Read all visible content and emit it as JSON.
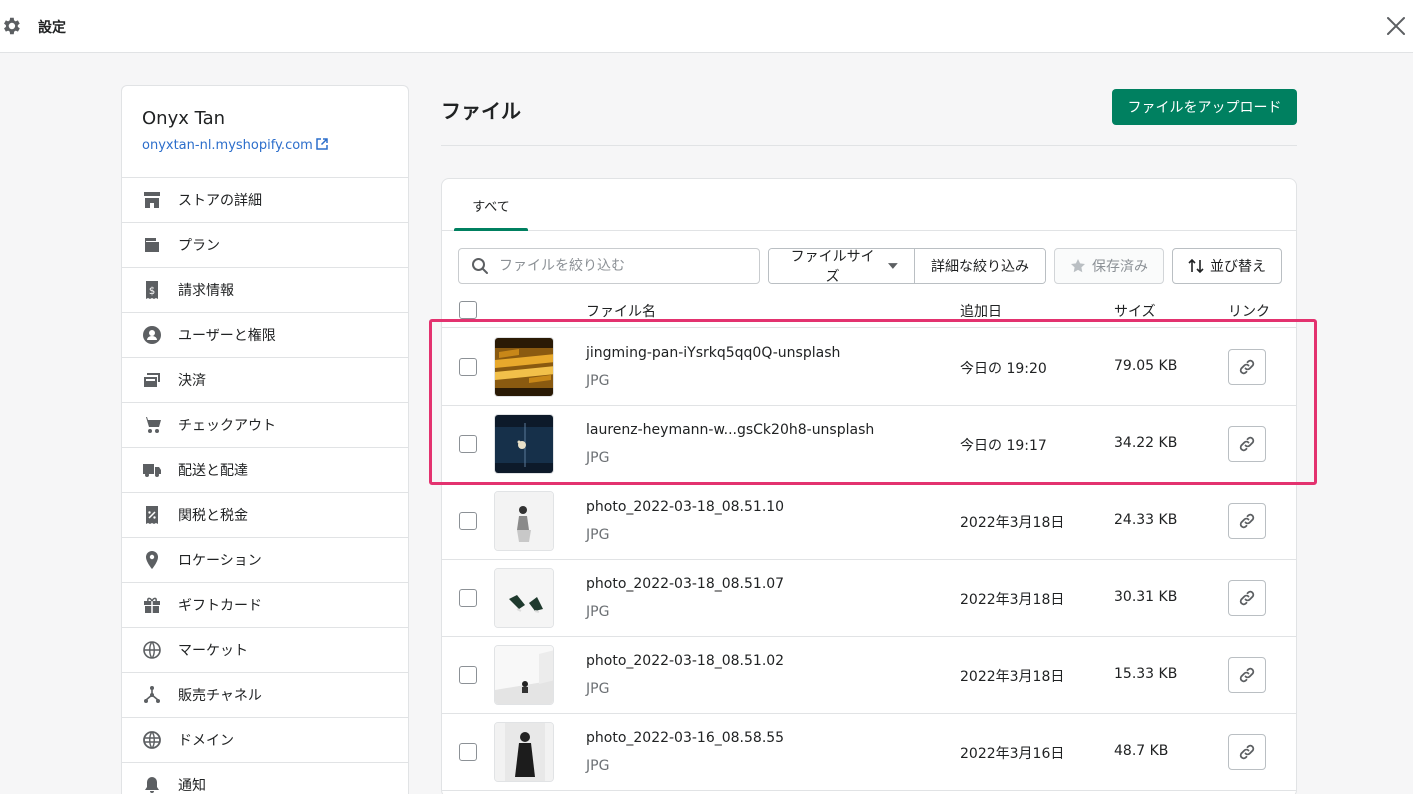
{
  "topbar": {
    "title": "設定",
    "gear_icon": "gear-icon",
    "close_icon": "close-icon"
  },
  "sidebar": {
    "store_name": "Onyx Tan",
    "store_url": "onyxtan-nl.myshopify.com",
    "items": [
      {
        "label": "ストアの詳細",
        "icon": "store-icon"
      },
      {
        "label": "プラン",
        "icon": "wallet-icon"
      },
      {
        "label": "請求情報",
        "icon": "billing-icon"
      },
      {
        "label": "ユーザーと権限",
        "icon": "user-icon"
      },
      {
        "label": "決済",
        "icon": "payments-icon"
      },
      {
        "label": "チェックアウト",
        "icon": "cart-icon"
      },
      {
        "label": "配送と配達",
        "icon": "truck-icon"
      },
      {
        "label": "関税と税金",
        "icon": "tax-icon"
      },
      {
        "label": "ロケーション",
        "icon": "location-icon"
      },
      {
        "label": "ギフトカード",
        "icon": "gift-icon"
      },
      {
        "label": "マーケット",
        "icon": "globe-icon"
      },
      {
        "label": "販売チャネル",
        "icon": "channels-icon"
      },
      {
        "label": "ドメイン",
        "icon": "domain-icon"
      },
      {
        "label": "通知",
        "icon": "bell-icon"
      }
    ]
  },
  "main": {
    "title": "ファイル",
    "upload_label": "ファイルをアップロード",
    "tabs": [
      {
        "label": "すべて"
      }
    ],
    "search_placeholder": "ファイルを絞り込む",
    "filter_size_label": "ファイルサイズ",
    "filter_more_label": "詳細な絞り込み",
    "saved_label": "保存済み",
    "sort_label": "並び替え",
    "columns": {
      "name": "ファイル名",
      "date": "追加日",
      "size": "サイズ",
      "link": "リンク"
    },
    "rows": [
      {
        "name": "jingming-pan-iYsrkq5qq0Q-unsplash",
        "type": "JPG",
        "date": "今日の 19:20",
        "size": "79.05 KB",
        "thumb": "gold-bars-image"
      },
      {
        "name": "laurenz-heymann-w...gsCk20h8-unsplash",
        "type": "JPG",
        "date": "今日の 19:17",
        "size": "34.22 KB",
        "thumb": "apple-logo-image"
      },
      {
        "name": "photo_2022-03-18_08.51.10",
        "type": "JPG",
        "date": "2022年3月18日",
        "size": "24.33 KB",
        "thumb": "person-sitting-image"
      },
      {
        "name": "photo_2022-03-18_08.51.07",
        "type": "JPG",
        "date": "2022年3月18日",
        "size": "30.31 KB",
        "thumb": "sneakers-image"
      },
      {
        "name": "photo_2022-03-18_08.51.02",
        "type": "JPG",
        "date": "2022年3月18日",
        "size": "15.33 KB",
        "thumb": "person-white-room-image"
      },
      {
        "name": "photo_2022-03-16_08.58.55",
        "type": "JPG",
        "date": "2022年3月16日",
        "size": "48.7 KB",
        "thumb": "person-black-dress-image"
      }
    ]
  },
  "colors": {
    "primary": "#008060",
    "link": "#2c6ecb",
    "highlight": "#e3326f"
  }
}
